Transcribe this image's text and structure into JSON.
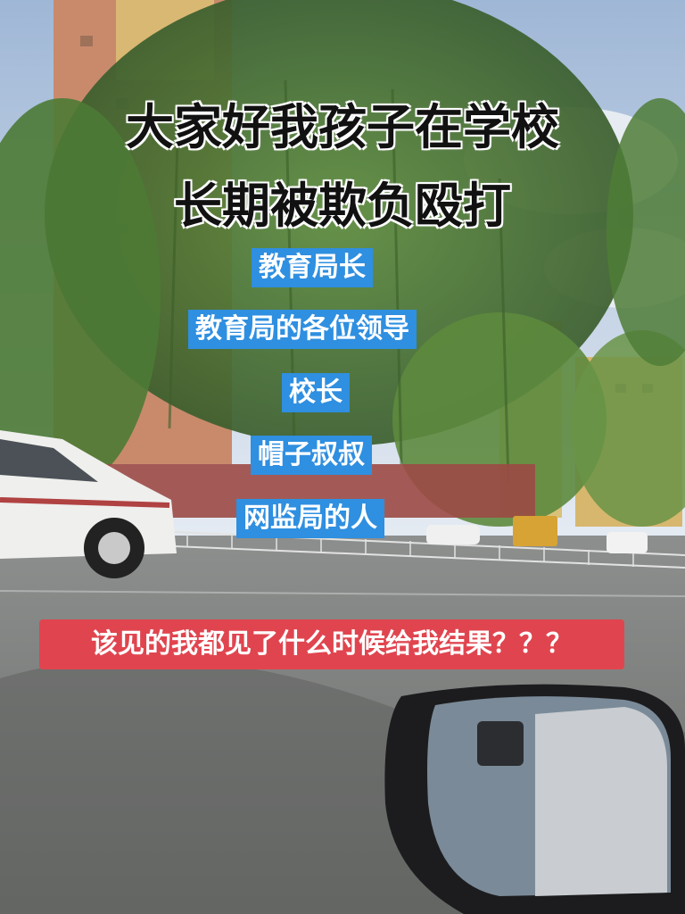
{
  "title": {
    "line1": "大家好我孩子在学校",
    "line2": "长期被欺负殴打"
  },
  "tags": [
    "教育局长",
    "教育局的各位领导",
    "校长",
    "帽子叔叔",
    "网监局的人"
  ],
  "banner": "该见的我都见了什么时候给我结果？？？",
  "colors": {
    "tag_bg": "#2f8fe0",
    "banner_bg": "#e0454f"
  }
}
